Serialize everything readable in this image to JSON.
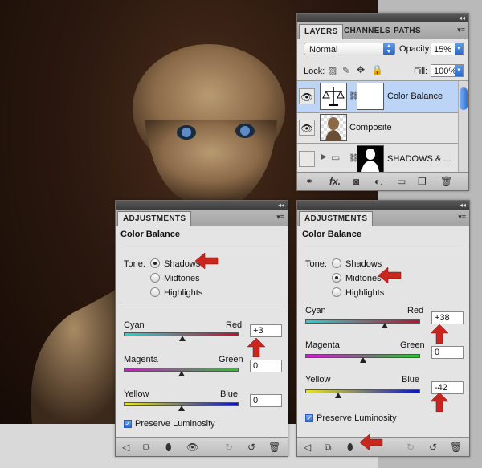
{
  "layers_panel": {
    "tabs": [
      "LAYERS",
      "CHANNELS",
      "PATHS"
    ],
    "blend_mode": "Normal",
    "opacity_label": "Opacity:",
    "opacity_value": "15%",
    "lock_label": "Lock:",
    "fill_label": "Fill:",
    "fill_value": "100%",
    "layers": [
      {
        "name": "Color Balance",
        "selected": true
      },
      {
        "name": "Composite",
        "selected": false
      },
      {
        "name": "SHADOWS & ...",
        "selected": false
      }
    ],
    "bottom_icons": [
      "link-icon",
      "fx-icon",
      "mask-icon",
      "adjustment-icon",
      "folder-icon",
      "new-layer-icon",
      "trash-icon"
    ]
  },
  "adjust_left": {
    "tab": "ADJUSTMENTS",
    "title": "Color Balance",
    "tone_label": "Tone:",
    "tones": [
      "Shadows",
      "Midtones",
      "Highlights"
    ],
    "selected_tone": "Shadows",
    "sliders": [
      {
        "left": "Cyan",
        "right": "Red",
        "value": "+3",
        "position": 0.51
      },
      {
        "left": "Magenta",
        "right": "Green",
        "value": "0",
        "position": 0.5
      },
      {
        "left": "Yellow",
        "right": "Blue",
        "value": "0",
        "position": 0.5
      }
    ],
    "preserve_label": "Preserve Luminosity"
  },
  "adjust_right": {
    "tab": "ADJUSTMENTS",
    "title": "Color Balance",
    "tone_label": "Tone:",
    "tones": [
      "Shadows",
      "Midtones",
      "Highlights"
    ],
    "selected_tone": "Midtones",
    "sliders": [
      {
        "left": "Cyan",
        "right": "Red",
        "value": "+38",
        "position": 0.69
      },
      {
        "left": "Magenta",
        "right": "Green",
        "value": "0",
        "position": 0.5
      },
      {
        "left": "Yellow",
        "right": "Blue",
        "value": "-42",
        "position": 0.29
      }
    ],
    "preserve_label": "Preserve Luminosity"
  },
  "colors": {
    "arrow": "#c8261f",
    "selected_layer": "#bcd4f6",
    "accent": "#2e6ad4"
  }
}
